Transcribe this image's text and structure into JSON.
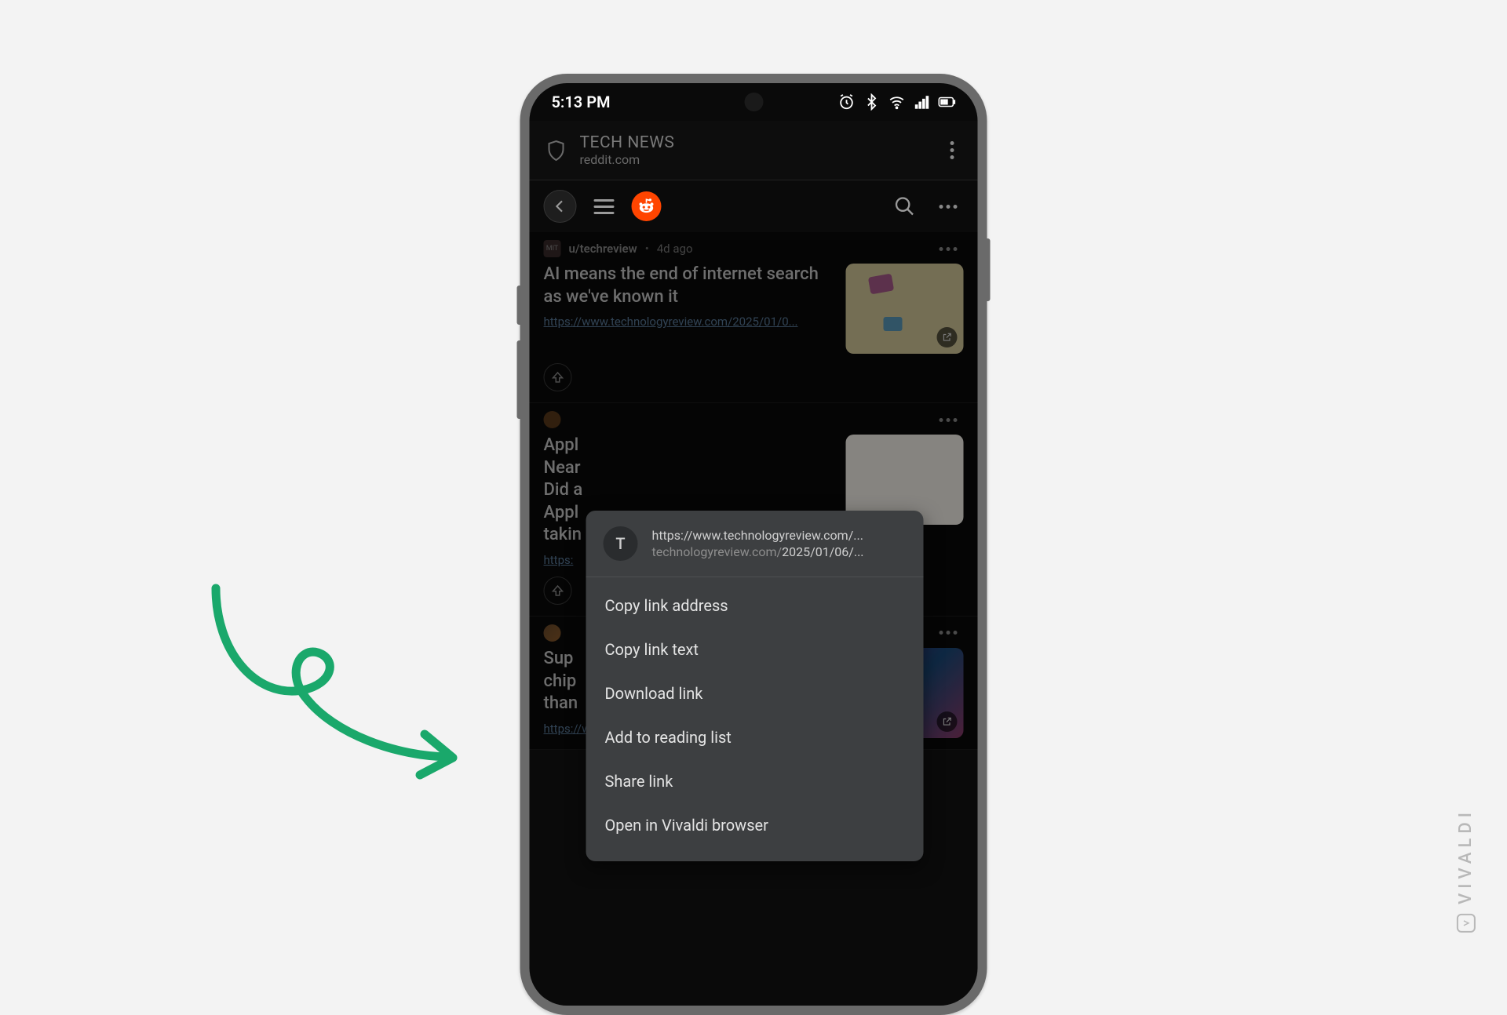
{
  "statusbar": {
    "time": "5:13 PM"
  },
  "addrbar": {
    "title": "TECH NEWS",
    "subtitle": "reddit.com"
  },
  "posts": [
    {
      "user": "u/techreview",
      "age": "4d ago",
      "title": "AI means the end of internet search as we've known it",
      "link": "https://www.technologyreview.com/2025/01/0..."
    },
    {
      "user": "",
      "age": "",
      "title": "Appl\nNear\nDid a\nAppl\ntakin",
      "link": "https:"
    },
    {
      "user": "",
      "age": "",
      "title": "Sup\nchip\nthan",
      "link": "https://www.livescience.com/technology/elect..."
    }
  ],
  "ctx": {
    "avatar_letter": "T",
    "url_line1": "https://www.technologyreview.com/...",
    "url_line2_dim": "technologyreview.com/",
    "url_line2_rest": "2025/01/06/...",
    "items": [
      "Copy link address",
      "Copy link text",
      "Download link",
      "Add to reading list",
      "Share link",
      "Open in Vivaldi browser"
    ]
  },
  "watermark": "VIVALDI"
}
